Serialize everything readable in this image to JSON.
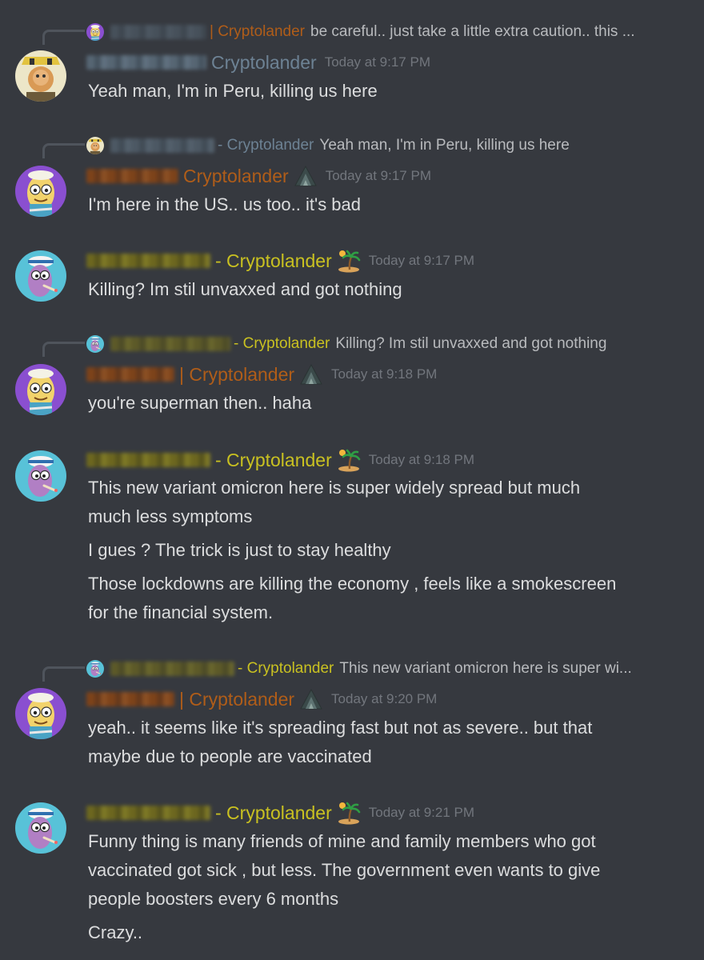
{
  "messages": [
    {
      "reply": {
        "name": "| Cryptolander",
        "text": "be careful.. just take a little extra caution.. this ..."
      },
      "user": {
        "name": "Cryptolander"
      },
      "timestamp": "Today at 9:17 PM",
      "lines": [
        "Yeah man, I'm in Peru, killing us here"
      ]
    },
    {
      "reply": {
        "name": "- Cryptolander",
        "text": "Yeah man, I'm in Peru, killing us here"
      },
      "user": {
        "name": "Cryptolander"
      },
      "timestamp": "Today at 9:17 PM",
      "lines": [
        "I'm here in the US.. us too.. it's bad"
      ]
    },
    {
      "user": {
        "name": "- Cryptolander"
      },
      "timestamp": "Today at 9:17 PM",
      "lines": [
        "Killing? Im stil unvaxxed and got nothing"
      ]
    },
    {
      "reply": {
        "name": "- Cryptolander",
        "text": "Killing? Im stil unvaxxed and got nothing"
      },
      "user": {
        "name": "| Cryptolander"
      },
      "timestamp": "Today at 9:18 PM",
      "lines": [
        "you're superman then.. haha"
      ]
    },
    {
      "user": {
        "name": "- Cryptolander"
      },
      "timestamp": "Today at 9:18 PM",
      "lines": [
        "This new variant omicron here is super widely spread but much",
        "much less symptoms",
        "I gues ? The trick is just to stay healthy",
        "Those lockdowns are killing the economy , feels like a smokescreen",
        "for the financial system."
      ]
    },
    {
      "reply": {
        "name": "- Cryptolander",
        "text": "This new variant omicron here is super wi..."
      },
      "user": {
        "name": "| Cryptolander"
      },
      "timestamp": "Today at 9:20 PM",
      "lines": [
        "yeah.. it seems like it's spreading fast but not as severe.. but that",
        "maybe due to people are vaccinated"
      ]
    },
    {
      "user": {
        "name": "- Cryptolander"
      },
      "timestamp": "Today at 9:21 PM",
      "lines": [
        "Funny thing is many friends of mine and family members who got",
        "vaccinated got sick , but less. The government even wants to give",
        "people boosters every 6 months",
        "Crazy.."
      ]
    }
  ],
  "colors": {
    "background": "#36393f",
    "text": "#dcddde",
    "reply_text": "#b9bbbe",
    "timestamp": "#72767d",
    "name_blue": "#6d8294",
    "name_orange": "#b05d19",
    "name_yellow": "#c9c121"
  },
  "icons": {
    "reply_connector": "reply-spine-icon",
    "server_badge_orange_user": "mountain-icon",
    "server_badge_yellow_user": "palm-island-icon"
  }
}
